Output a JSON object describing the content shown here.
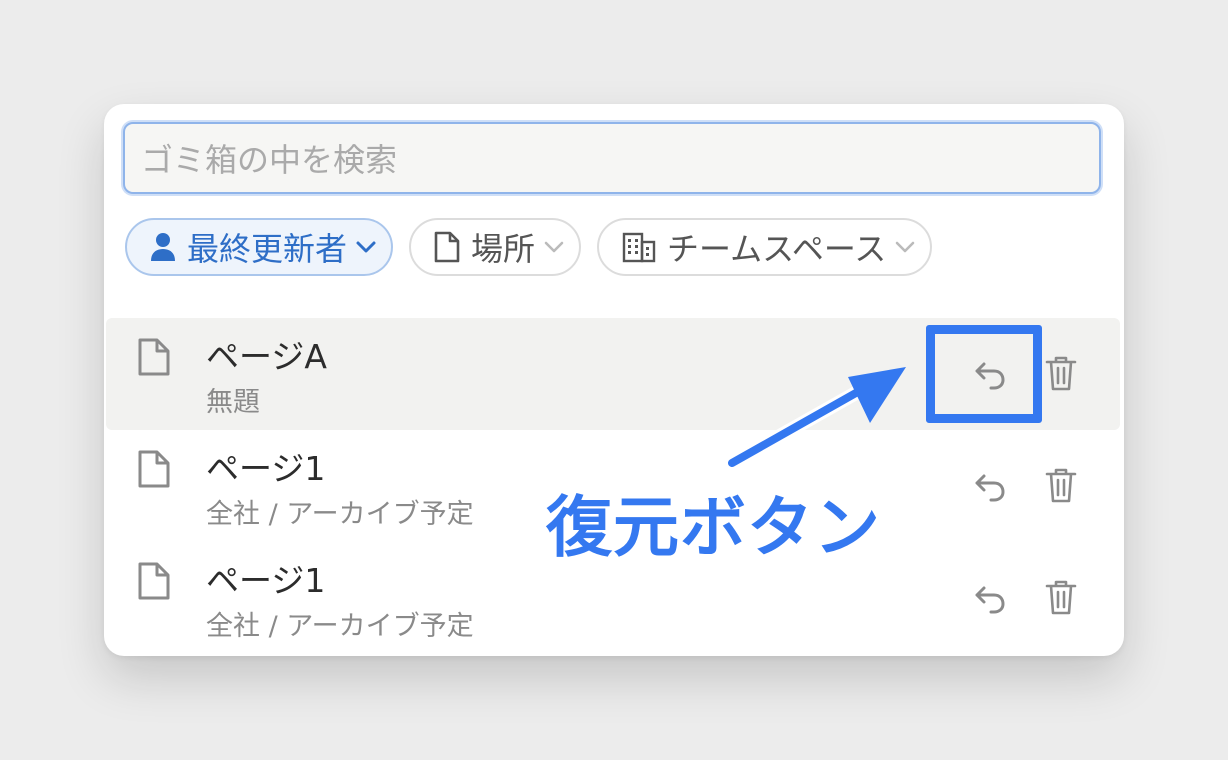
{
  "search": {
    "placeholder": "ゴミ箱の中を検索"
  },
  "filters": [
    {
      "label": "最終更新者",
      "icon": "person-icon",
      "active": true
    },
    {
      "label": "場所",
      "icon": "document-icon",
      "active": false
    },
    {
      "label": "チームスペース",
      "icon": "building-icon",
      "active": false
    }
  ],
  "rows": [
    {
      "title": "ページA",
      "subtitle": "無題",
      "hover": true
    },
    {
      "title": "ページ1",
      "subtitle": "全社 / アーカイブ予定",
      "hover": false
    },
    {
      "title": "ページ1",
      "subtitle": "全社 / アーカイブ予定",
      "hover": false
    }
  ],
  "annotation": {
    "label": "復元ボタン",
    "color": "#3478f0"
  },
  "colors": {
    "accent": "#3478f0",
    "chip_active_text": "#2e6ec7"
  }
}
